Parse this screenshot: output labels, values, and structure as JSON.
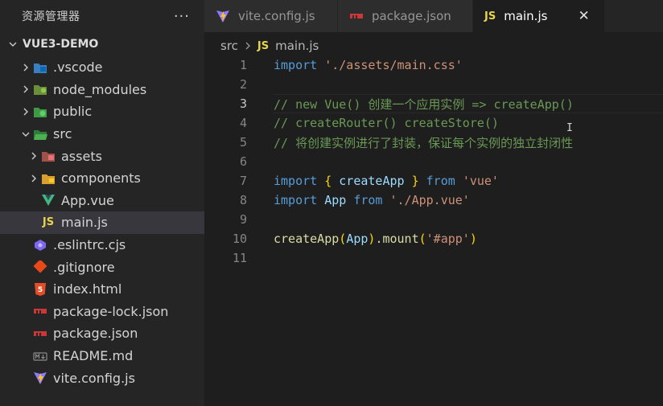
{
  "sidebar": {
    "title": "资源管理器",
    "more": "···",
    "project": "VUE3-DEMO",
    "items": [
      {
        "label": ".vscode"
      },
      {
        "label": "node_modules"
      },
      {
        "label": "public"
      },
      {
        "label": "src"
      },
      {
        "label": "assets"
      },
      {
        "label": "components"
      },
      {
        "label": "App.vue"
      },
      {
        "label": "main.js"
      },
      {
        "label": ".eslintrc.cjs"
      },
      {
        "label": ".gitignore"
      },
      {
        "label": "index.html"
      },
      {
        "label": "package-lock.json"
      },
      {
        "label": "package.json"
      },
      {
        "label": "README.md"
      },
      {
        "label": "vite.config.js"
      }
    ]
  },
  "tabs": [
    {
      "label": "vite.config.js"
    },
    {
      "label": "package.json"
    },
    {
      "label": "main.js",
      "close": "✕"
    }
  ],
  "breadcrumb": {
    "folder": "src",
    "badge": "JS",
    "file": "main.js"
  },
  "editor": {
    "line_numbers": [
      "1",
      "2",
      "3",
      "4",
      "5",
      "6",
      "7",
      "8",
      "9",
      "10",
      "11"
    ],
    "line1": {
      "kw": "import",
      "str": "'./assets/main.css'"
    },
    "line3": "// new Vue() 创建一个应用实例 => createApp()",
    "line4": "// createRouter() createStore()",
    "line5": "// 将创建实例进行了封装，保证每个实例的独立封闭性",
    "line7": {
      "kw": "import",
      "ob": "{",
      "name": "createApp",
      "cb": "}",
      "from": "from",
      "str": "'vue'"
    },
    "line8": {
      "kw": "import",
      "name": "App",
      "from": "from",
      "str": "'./App.vue'"
    },
    "line10": {
      "fn": "createApp",
      "op": "(",
      "arg": "App",
      "cp": ")",
      "dot": ".",
      "method": "mount",
      "op2": "(",
      "str": "'#app'",
      "cp2": ")"
    },
    "cursor": "I"
  },
  "colors": {
    "js": "#e8d44d",
    "vue": "#41b883",
    "npm": "#cb3837",
    "folder": "#dcb67a"
  }
}
